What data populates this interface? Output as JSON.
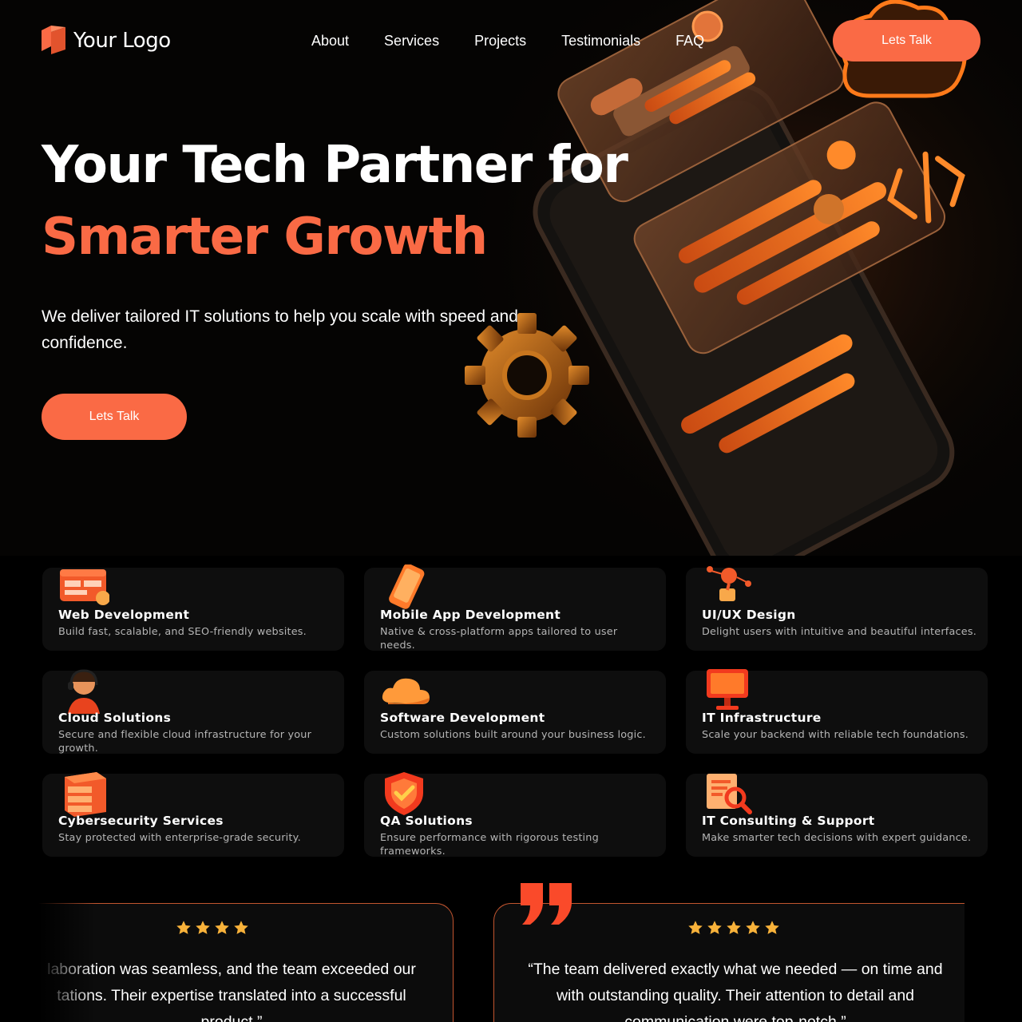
{
  "brand": {
    "logo_text": "Your Logo",
    "accent": "#fa6a45"
  },
  "nav": {
    "items": [
      "About",
      "Services",
      "Projects",
      "Testimonials",
      "FAQ"
    ],
    "cta": "Lets Talk"
  },
  "hero": {
    "title_line1": "Your Tech Partner for",
    "title_line2": "Smarter Growth",
    "subtitle": "We deliver tailored IT solutions to help you scale with speed and confidence.",
    "cta": "Lets Talk"
  },
  "services": [
    {
      "icon": "browser-window-icon",
      "title": "Web Development",
      "desc": "Build fast, scalable, and SEO-friendly websites."
    },
    {
      "icon": "smartphone-icon",
      "title": "Mobile App Development",
      "desc": "Native & cross-platform apps tailored to user needs."
    },
    {
      "icon": "design-tool-icon",
      "title": "UI/UX Design",
      "desc": "Delight users with intuitive and beautiful interfaces."
    },
    {
      "icon": "headset-person-icon",
      "title": "Cloud Solutions",
      "desc": "Secure and flexible cloud infrastructure for your growth."
    },
    {
      "icon": "cloud-icon",
      "title": "Software Development",
      "desc": "Custom solutions built around your business logic."
    },
    {
      "icon": "monitor-icon",
      "title": "IT Infrastructure",
      "desc": "Scale your backend with reliable tech foundations."
    },
    {
      "icon": "server-icon",
      "title": "Cybersecurity Services",
      "desc": "Stay protected with enterprise-grade security."
    },
    {
      "icon": "shield-check-icon",
      "title": "QA Solutions",
      "desc": "Ensure performance with rigorous testing frameworks."
    },
    {
      "icon": "document-search-icon",
      "title": "IT Consulting & Support",
      "desc": "Make smarter tech decisions with expert guidance."
    }
  ],
  "testimonials": [
    {
      "stars": 4,
      "line1": "laboration was seamless, and the team exceeded our",
      "line2": "tations. Their expertise translated into a successful",
      "line3": "product.”"
    },
    {
      "stars": 5,
      "line1": "“The team delivered exactly what we needed — on time and",
      "line2": "with outstanding quality. Their attention to detail and",
      "line3": "communication were top-notch.”"
    }
  ]
}
